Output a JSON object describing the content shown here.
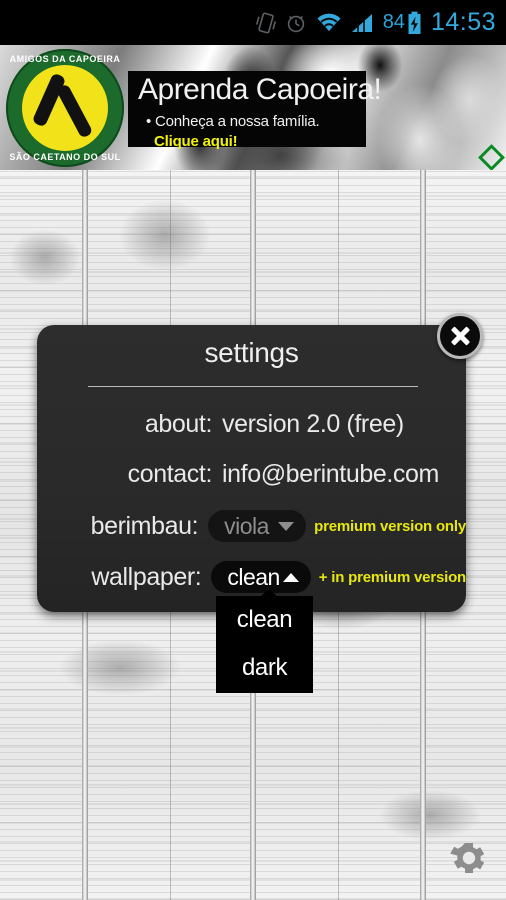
{
  "status_bar": {
    "icons": [
      "vibrate-icon",
      "alarm-icon",
      "wifi-icon",
      "signal-icon",
      "battery-icon"
    ],
    "battery_level": "84",
    "time": "14:53",
    "accent_color": "#32a8dc"
  },
  "banner_ad": {
    "logo": {
      "top_text": "AMIGOS DA CAPOEIRA",
      "bottom_text": "SÃO CAETANO DO SUL"
    },
    "headline": "Aprenda Capoeira!",
    "bullet": "• Conheça a nossa família.",
    "call_to_action": "Clique aqui!",
    "cta_color": "#f3f309",
    "network_badge": "admob-icon"
  },
  "dialog": {
    "title": "settings",
    "close_label": "close-icon",
    "rows": [
      {
        "label": "about:",
        "value": "version 2.0 (free)",
        "type": "text"
      },
      {
        "label": "contact:",
        "value": "info@berintube.com",
        "type": "text"
      },
      {
        "label": "berimbau:",
        "value": "viola",
        "type": "spinner",
        "enabled": false,
        "note": "premium version only"
      },
      {
        "label": "wallpaper:",
        "value": "clean",
        "type": "spinner",
        "enabled": true,
        "note": "+ in premium version"
      }
    ],
    "note_color": "#e7e70d"
  },
  "dropdown": {
    "open": true,
    "options": [
      "clean",
      "dark"
    ],
    "selected": "clean"
  },
  "wallpaper": {
    "name": "clean",
    "style": "light wood planks"
  },
  "gear_button": {
    "name": "settings-gear-icon"
  }
}
